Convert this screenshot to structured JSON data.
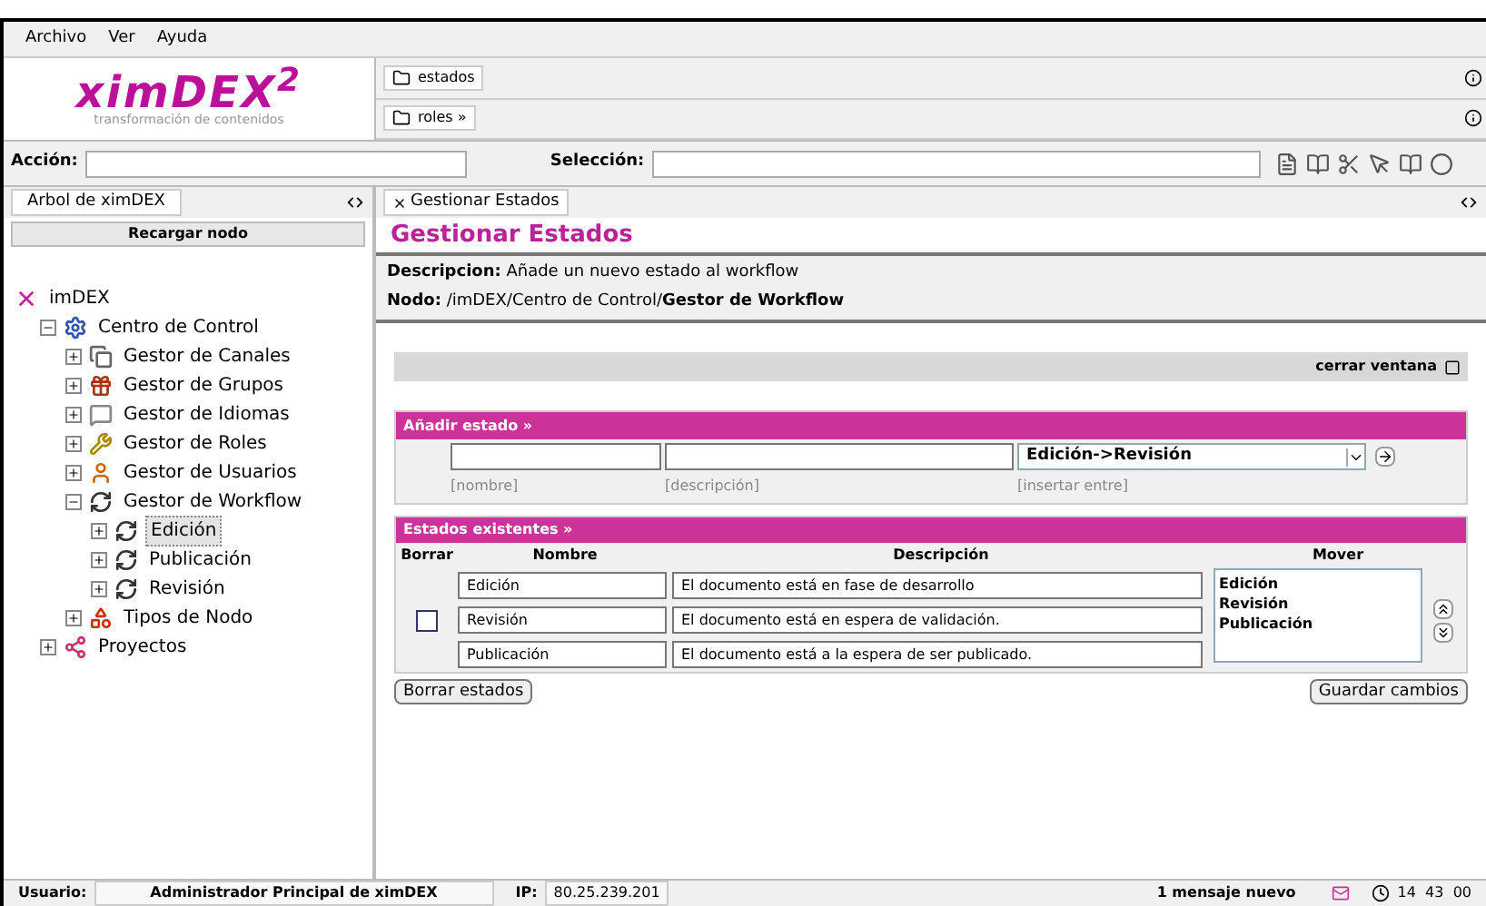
{
  "menu": [
    "Archivo",
    "Ver",
    "Ayuda"
  ],
  "logo": {
    "text": "ximDEX$^{2}$",
    "subtitle": "transformación de contenidos"
  },
  "header_tabs": [
    {
      "label": "estados"
    },
    {
      "label": "roles »"
    }
  ],
  "action_bar": {
    "action_label": "Acción:",
    "selection_label": "Selección:"
  },
  "left_panel": {
    "tab": "Arbol de ximDEX",
    "reload_button": "Recargar nodo",
    "tree": [
      {
        "label": "imDEX",
        "kind": "root",
        "selected": false,
        "children": [
          {
            "label": "Centro de Control",
            "kind": "control",
            "expanded": true,
            "selected": false,
            "children": [
              {
                "label": "Gestor de Canales",
                "kind": "channels",
                "expanded": false,
                "selected": false
              },
              {
                "label": "Gestor de Grupos",
                "kind": "groups",
                "expanded": false,
                "selected": false
              },
              {
                "label": "Gestor de Idiomas",
                "kind": "languages",
                "expanded": false,
                "selected": false
              },
              {
                "label": "Gestor de Roles",
                "kind": "roles",
                "expanded": false,
                "selected": false
              },
              {
                "label": "Gestor de Usuarios",
                "kind": "users",
                "expanded": false,
                "selected": false
              },
              {
                "label": "Gestor de Workflow",
                "kind": "workflow",
                "expanded": true,
                "selected": false,
                "children": [
                  {
                    "label": "Edición",
                    "kind": "workflow",
                    "expanded": false,
                    "selected": true
                  },
                  {
                    "label": "Publicación",
                    "kind": "workflow",
                    "expanded": false,
                    "selected": false
                  },
                  {
                    "label": "Revisión",
                    "kind": "workflow",
                    "expanded": false,
                    "selected": false
                  }
                ]
              },
              {
                "label": "Tipos de Nodo",
                "kind": "nodetypes",
                "expanded": false,
                "selected": false
              }
            ]
          },
          {
            "label": "Proyectos",
            "kind": "projects",
            "expanded": false,
            "selected": false
          }
        ]
      }
    ]
  },
  "content": {
    "tab": "Gestionar Estados",
    "title": "Gestionar Estados",
    "description_label": "Descripcion:",
    "description": "Añade un nuevo estado al workflow",
    "node_label": "Nodo:",
    "node_path": "/imDEX/Centro de Control/**Gestor de Workflow**",
    "close_window": "cerrar ventana",
    "add_section": {
      "title": "Añadir estado »",
      "select_value": "Edición->Revisión",
      "hints": [
        "[nombre]",
        "[descripción]",
        "[insertar entre]"
      ]
    },
    "existing_section": {
      "title": "Estados existentes »",
      "columns": [
        "Borrar",
        "Nombre",
        "Descripción",
        "Mover"
      ],
      "delete_checkbox": {
        "checked": false
      },
      "rows": [
        {
          "name": "Edición",
          "description": "El documento está en fase de desarrollo"
        },
        {
          "name": "Revisión",
          "description": "El documento está en espera de validación."
        },
        {
          "name": "Publicación",
          "description": "El documento está a la espera de ser publicado."
        }
      ],
      "move_list": [
        {
          "label": "Edición",
          "selected": false
        },
        {
          "label": "Revisión",
          "selected": false
        },
        {
          "label": "Publicación",
          "selected": false
        }
      ]
    },
    "delete_button": "Borrar estados",
    "save_button": "Guardar cambios"
  },
  "status_bar": {
    "user_label": "Usuario:",
    "user": "Administrador Principal de ximDEX",
    "ip_label": "IP:",
    "ip": "80.25.239.201",
    "messages": "1 mensaje nuevo",
    "time": "14  43  00"
  }
}
